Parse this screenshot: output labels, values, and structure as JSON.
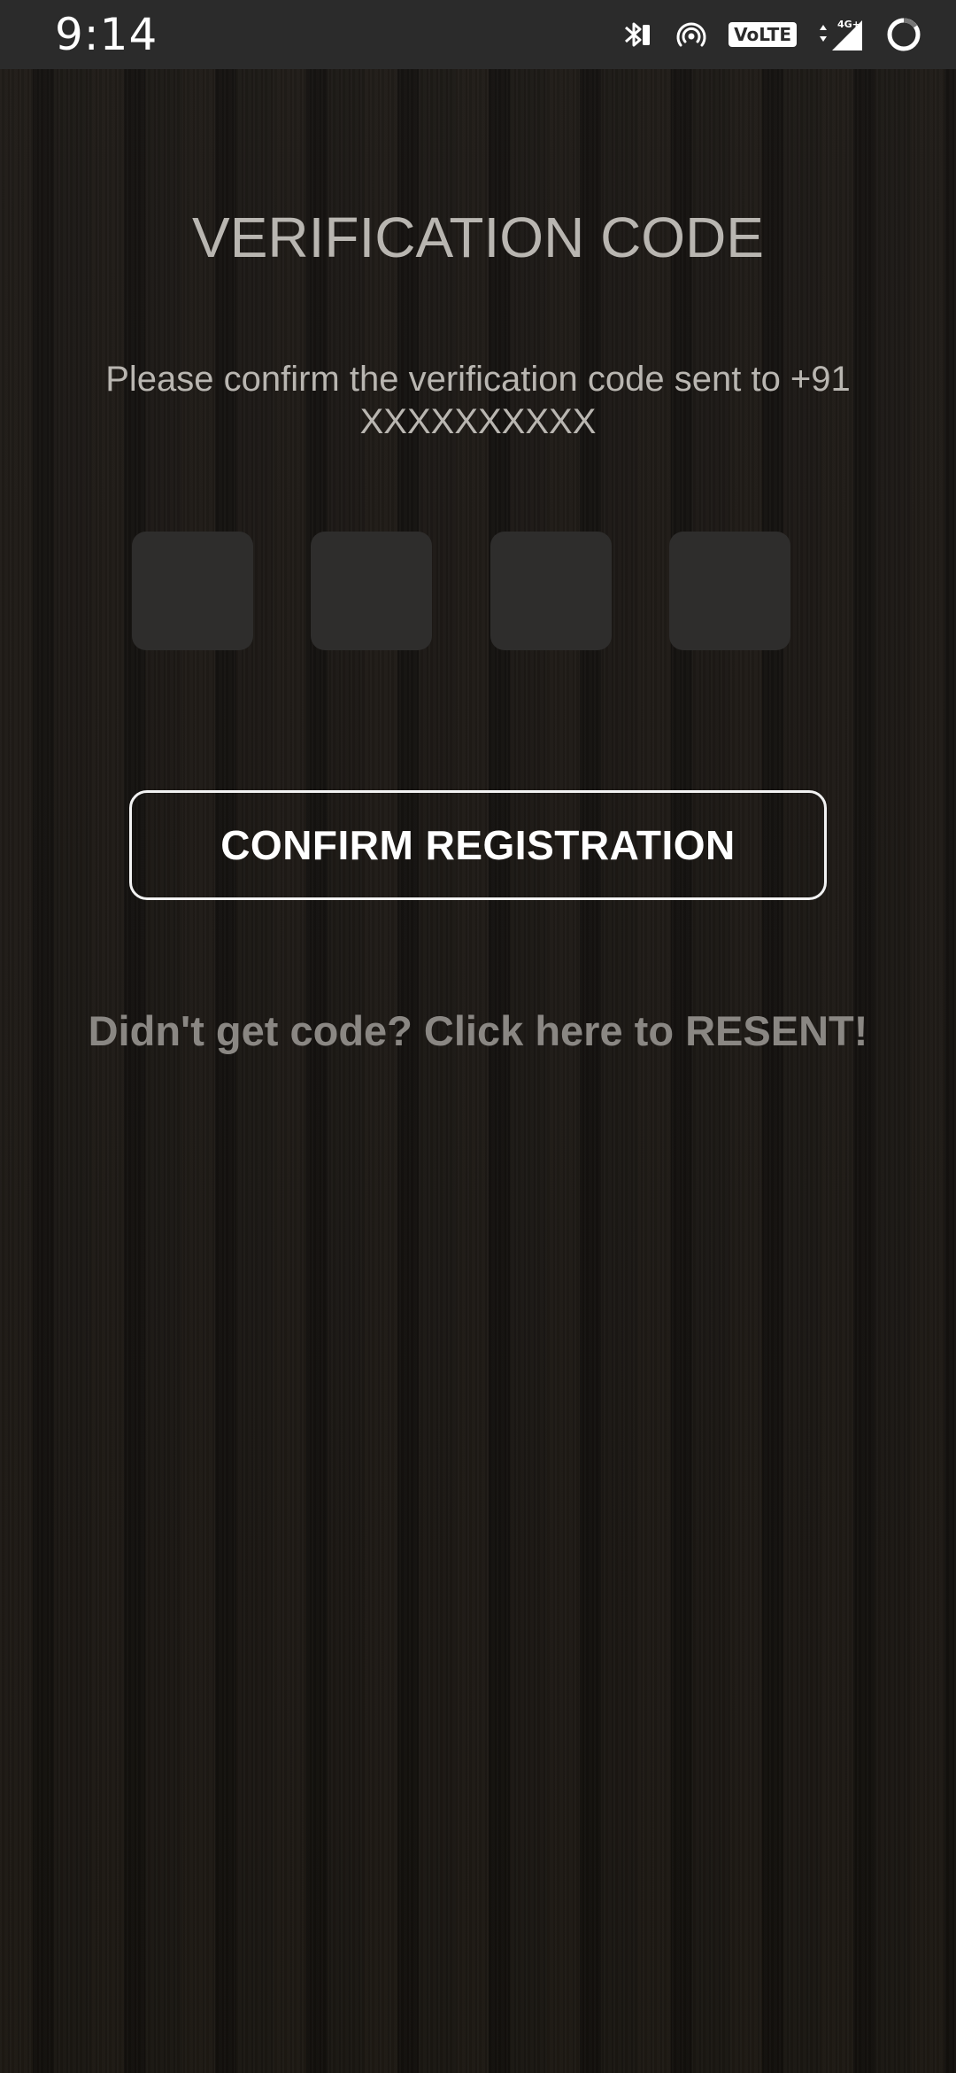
{
  "status_bar": {
    "time": "9:14",
    "icons": [
      "bluetooth-icon",
      "hotspot-icon",
      "volte-icon",
      "data-arrows-icon",
      "signal-4g-icon",
      "battery-ring-icon"
    ],
    "volte_label": "VoLTE",
    "network_label": "4G+"
  },
  "verification": {
    "title": "VERIFICATION CODE",
    "subtitle": "Please confirm the verification code sent to +91 XXXXXXXXXX",
    "code_digits": [
      "",
      "",
      "",
      ""
    ]
  },
  "actions": {
    "confirm_label": "CONFIRM REGISTRATION",
    "resend_label": "Didn't get code? Click here to RESENT!"
  },
  "colors": {
    "status_bar_bg": "#2b2b2b",
    "background": "#1a1714",
    "title_text": "#b9b6b1",
    "code_box_bg": "#2e2d2c",
    "button_border": "#f2f2f2",
    "resend_text": "#8a8783"
  }
}
